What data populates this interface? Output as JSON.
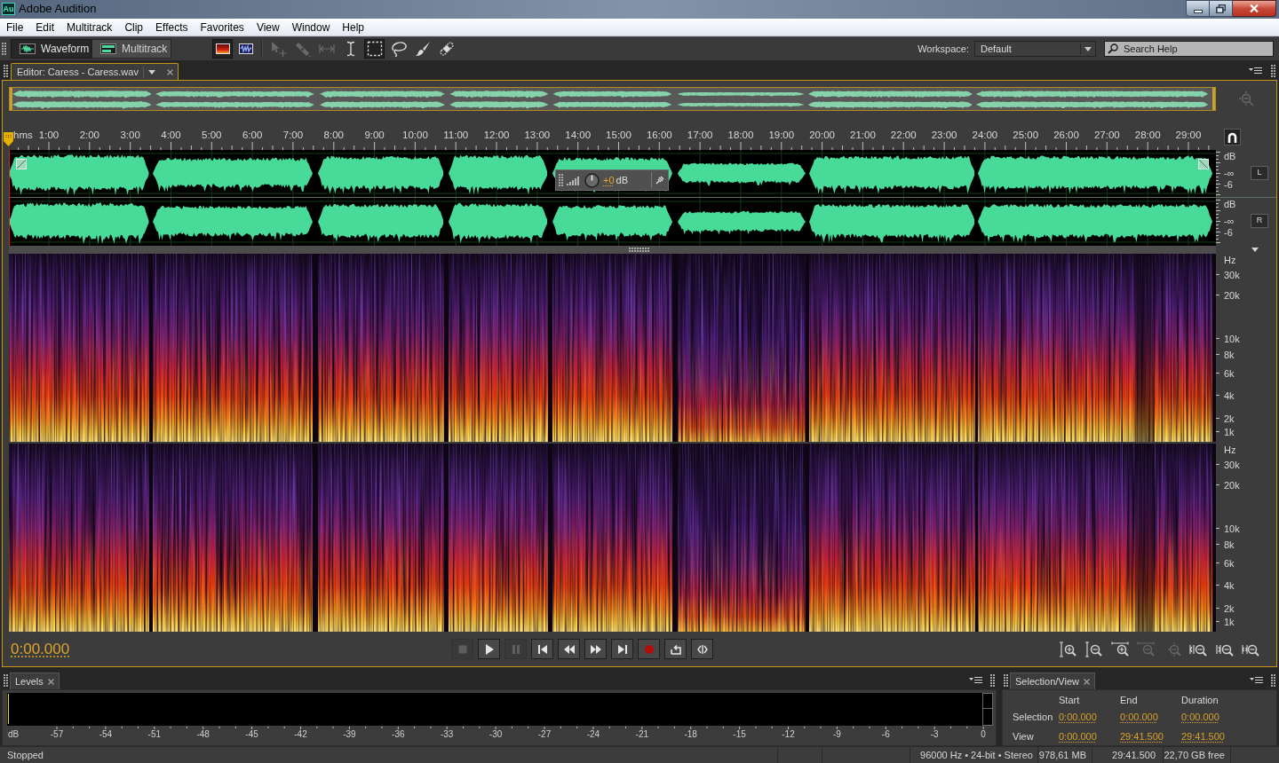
{
  "window": {
    "badge": "Au",
    "title": "Adobe Audition"
  },
  "menu": [
    "File",
    "Edit",
    "Multitrack",
    "Clip",
    "Effects",
    "Favorites",
    "View",
    "Window",
    "Help"
  ],
  "toolbar": {
    "modes": [
      {
        "kind": "waveform",
        "label": "Waveform",
        "selected": true
      },
      {
        "kind": "multitrack",
        "label": "Multitrack",
        "selected": false
      }
    ],
    "displays": [
      {
        "kind": "spectral",
        "selected": true
      },
      {
        "kind": "waveform",
        "selected": false
      }
    ],
    "tools": [
      {
        "kind": "move",
        "disabled": true,
        "selected": false
      },
      {
        "kind": "razor",
        "disabled": true,
        "selected": false
      },
      {
        "kind": "slip",
        "disabled": true,
        "selected": false
      },
      {
        "kind": "time_selection",
        "disabled": false,
        "selected": false
      },
      {
        "kind": "marquee",
        "disabled": false,
        "selected": true
      },
      {
        "kind": "lasso",
        "disabled": false,
        "selected": false
      },
      {
        "kind": "brush",
        "disabled": false,
        "selected": false
      },
      {
        "kind": "spot_healing",
        "disabled": false,
        "selected": false
      }
    ],
    "workspace": {
      "label": "Workspace:",
      "value": "Default"
    },
    "search": {
      "placeholder": "Search Help"
    }
  },
  "editor": {
    "tab": "Editor: Caress - Caress.wav",
    "ruler": {
      "unit": "hms",
      "labels": [
        "1:00",
        "2:00",
        "3:00",
        "4:00",
        "5:00",
        "6:00",
        "7:00",
        "8:00",
        "9:00",
        "10:00",
        "11:00",
        "12:00",
        "13:00",
        "14:00",
        "15:00",
        "16:00",
        "17:00",
        "18:00",
        "19:00",
        "20:00",
        "21:00",
        "22:00",
        "23:00",
        "24:00",
        "25:00",
        "26:00",
        "27:00",
        "28:00",
        "29:00"
      ]
    },
    "channels": [
      {
        "label": "L",
        "unit": "dB",
        "scale": [
          "-∞",
          "-6"
        ]
      },
      {
        "label": "R",
        "unit": "dB",
        "scale": [
          "-∞",
          "-6"
        ]
      }
    ],
    "gain_hud": {
      "value": "+0",
      "unit": "dB"
    },
    "spectral_channels": [
      {
        "unit": "Hz",
        "scale": [
          "30k",
          "20k",
          "10k",
          "8k",
          "6k",
          "4k",
          "2k",
          "1k"
        ]
      },
      {
        "unit": "Hz",
        "scale": [
          "30k",
          "20k",
          "10k",
          "8k",
          "6k",
          "4k",
          "2k",
          "1k"
        ]
      }
    ],
    "time": "0:00.000",
    "transport": [
      {
        "kind": "stop",
        "disabled": true
      },
      {
        "kind": "play",
        "disabled": false
      },
      {
        "kind": "pause",
        "disabled": true
      },
      {
        "kind": "to_start",
        "disabled": false
      },
      {
        "kind": "rewind",
        "disabled": false
      },
      {
        "kind": "forward",
        "disabled": false
      },
      {
        "kind": "to_end",
        "disabled": false
      },
      {
        "kind": "record",
        "disabled": false
      },
      {
        "kind": "loop",
        "disabled": false
      },
      {
        "kind": "skip",
        "disabled": false
      }
    ],
    "zoom": [
      {
        "kind": "in_amplitude",
        "disabled": false
      },
      {
        "kind": "out_amplitude",
        "disabled": false
      },
      {
        "kind": "in_time",
        "disabled": false
      },
      {
        "kind": "out_time",
        "disabled": true
      },
      {
        "kind": "out_full",
        "disabled": true
      },
      {
        "kind": "in_point",
        "disabled": false
      },
      {
        "kind": "out_point",
        "disabled": false
      },
      {
        "kind": "selection",
        "disabled": false
      }
    ]
  },
  "levels": {
    "tab": "Levels",
    "unit": "dB",
    "scale": [
      "-57",
      "-54",
      "-51",
      "-48",
      "-45",
      "-42",
      "-39",
      "-36",
      "-33",
      "-30",
      "-27",
      "-24",
      "-21",
      "-18",
      "-15",
      "-12",
      "-9",
      "-6",
      "-3",
      "0"
    ]
  },
  "selection_view": {
    "tab": "Selection/View",
    "columns": [
      "Start",
      "End",
      "Duration"
    ],
    "rows": [
      {
        "label": "Selection",
        "values": [
          "0:00.000",
          "0:00.000",
          "0:00.000"
        ]
      },
      {
        "label": "View",
        "values": [
          "0:00.000",
          "29:41.500",
          "29:41.500"
        ]
      }
    ]
  },
  "status_bar": {
    "state": "Stopped",
    "format": "96000 Hz • 24-bit • Stereo",
    "size": "978,61 MB",
    "duration": "29:41.500",
    "free": "22,70 GB free"
  }
}
